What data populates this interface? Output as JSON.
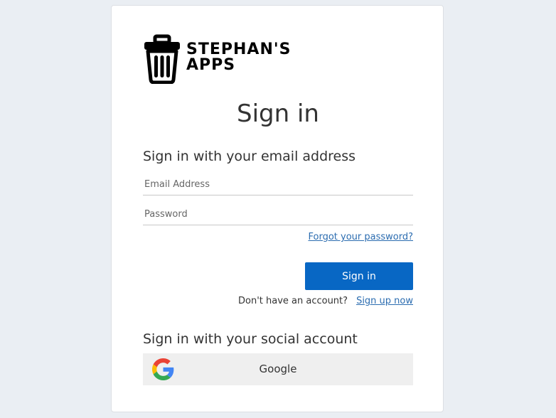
{
  "logo": {
    "line1": "STEPHAN'S",
    "line2": "APPS",
    "icon": "trash-can-icon"
  },
  "title": "Sign in",
  "email_section": {
    "heading": "Sign in with your email address",
    "email_placeholder": "Email Address",
    "password_placeholder": "Password",
    "forgot_link": "Forgot your password?",
    "signin_button": "Sign in",
    "signup_prompt": "Don't have an account?",
    "signup_link": "Sign up now"
  },
  "social_section": {
    "heading": "Sign in with your social account",
    "google_label": "Google",
    "google_icon": "google-g-icon"
  },
  "colors": {
    "primary_button": "#0867c4",
    "link": "#2b6cb0",
    "page_background": "#eaeef3"
  }
}
